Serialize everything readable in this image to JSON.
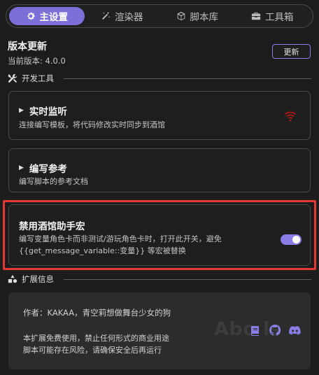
{
  "tabs": [
    {
      "label": "主设置",
      "icon": "gear-icon",
      "active": true
    },
    {
      "label": "渲染器",
      "icon": "magic-wand-icon",
      "active": false
    },
    {
      "label": "脚本库",
      "icon": "cube-icon",
      "active": false
    },
    {
      "label": "工具箱",
      "icon": "toolbox-icon",
      "active": false
    }
  ],
  "version": {
    "title": "版本更新",
    "current": "当前版本: 4.0.0",
    "update_label": "更新"
  },
  "dev_tools": {
    "label": "开发工具",
    "icon": "wrench-screwdriver-icon"
  },
  "realtime": {
    "title": "实时监听",
    "desc": "连接编写模板，将代码修改实时同步到酒馆",
    "status_icon": "wifi-icon",
    "status_color": "#a11a1a"
  },
  "reference": {
    "title": "编写参考",
    "desc": "编写脚本的参考文档"
  },
  "disable_macro": {
    "title": "禁用酒馆助手宏",
    "desc_line1": "编写变量角色卡而非测试/游玩角色卡时，打开此开关，避免",
    "desc_line2": "{{get_message_variable::变量}} 等宏被替换",
    "enabled": true
  },
  "ext_info": {
    "label": "扩展信息",
    "icon": "shapes-icon",
    "author": "作者：KAKAA，青空莉想做舞台少女的狗",
    "license_line1": "本扩展免费使用，禁止任何形式的商业用途",
    "license_line2": "脚本可能存在风险，请确保安全后再运行",
    "watermark": "Abo  ls",
    "links": [
      "book-icon",
      "github-icon",
      "discord-icon"
    ]
  },
  "colors": {
    "accent": "#7c6fd8",
    "highlight": "#e53935",
    "background": "#1c1c1c"
  }
}
